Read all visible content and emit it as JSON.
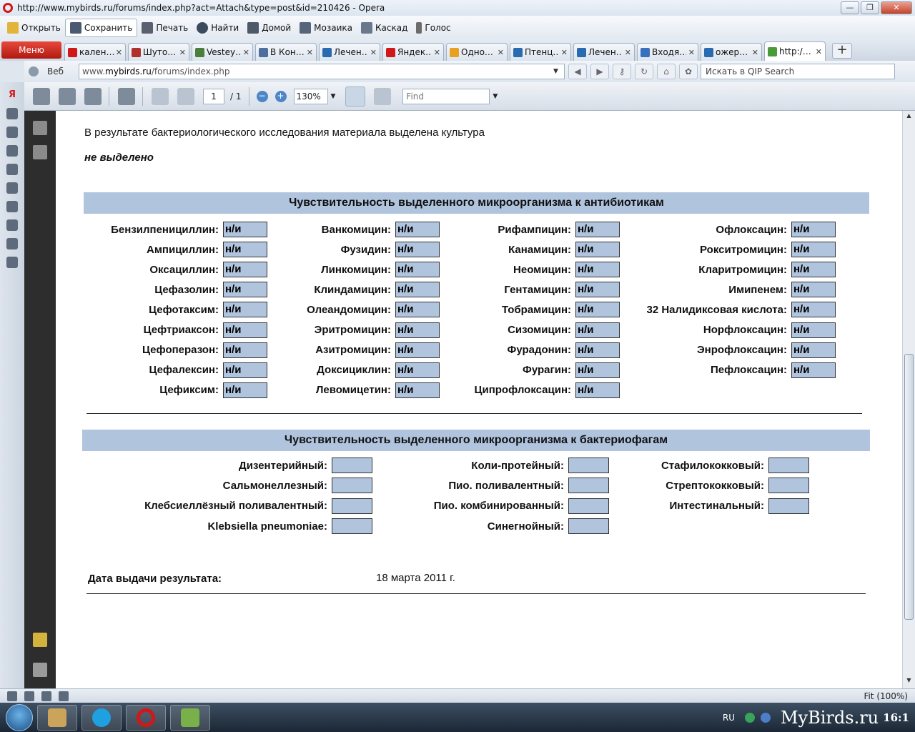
{
  "window": {
    "title": "http://www.mybirds.ru/forums/index.php?act=Attach&type=post&id=210426 - Opera",
    "btn_min": "—",
    "btn_max": "❐",
    "btn_close": "✕"
  },
  "toolbar": {
    "open": "Открыть",
    "save": "Сохранить",
    "print": "Печать",
    "find": "Найти",
    "home": "Домой",
    "tile": "Мозаика",
    "cascade": "Каскад",
    "voice": "Голос"
  },
  "tabs": {
    "menu": "Меню",
    "items": [
      {
        "label": "кален…",
        "color": "#d01818"
      },
      {
        "label": "Шуто…",
        "color": "#b0302a"
      },
      {
        "label": "Vestey…",
        "color": "#4a7e3a"
      },
      {
        "label": "В Кон…",
        "color": "#4d6fa0"
      },
      {
        "label": "Лечен…",
        "color": "#2a6ab0"
      },
      {
        "label": "Яндек…",
        "color": "#d01818"
      },
      {
        "label": "Одно…",
        "color": "#e8a020"
      },
      {
        "label": "Птенц…",
        "color": "#2a6ab0"
      },
      {
        "label": "Лечен…",
        "color": "#2a6ab0"
      },
      {
        "label": "Входя…",
        "color": "#3a6fc0"
      },
      {
        "label": "ожер…",
        "color": "#2a6ab0"
      },
      {
        "label": "http:/…",
        "color": "#4a9a3a"
      }
    ],
    "new_tab": "+"
  },
  "address": {
    "mode": "Веб",
    "url_prefix": "www.",
    "url_domain": "mybirds.ru",
    "url_path": "/forums/index.php",
    "search_placeholder": "Искать в QIP Search"
  },
  "pdf_toolbar": {
    "page": "1",
    "total": "/ 1",
    "zoom": "130%",
    "find_placeholder": "Find"
  },
  "document": {
    "intro": "В результате бактериологического исследования материала выделена культура",
    "culture": "не выделено",
    "antibiotics_title": "Чувствительность выделенного микроорганизма к антибиотикам",
    "antibiotics": [
      [
        {
          "name": "Бензилпенициллин:",
          "value": "н/и"
        },
        {
          "name": "Ампициллин:",
          "value": "н/и"
        },
        {
          "name": "Оксациллин:",
          "value": "н/и"
        },
        {
          "name": "Цефазолин:",
          "value": "н/и"
        },
        {
          "name": "Цефотаксим:",
          "value": "н/и"
        },
        {
          "name": "Цефтриаксон:",
          "value": "н/и"
        },
        {
          "name": "Цефоперазон:",
          "value": "н/и"
        },
        {
          "name": "Цефалексин:",
          "value": "н/и"
        },
        {
          "name": "Цефиксим:",
          "value": "н/и"
        }
      ],
      [
        {
          "name": "Ванкомицин:",
          "value": "н/и"
        },
        {
          "name": "Фузидин:",
          "value": "н/и"
        },
        {
          "name": "Линкомицин:",
          "value": "н/и"
        },
        {
          "name": "Клиндамицин:",
          "value": "н/и"
        },
        {
          "name": "Олеандомицин:",
          "value": "н/и"
        },
        {
          "name": "Эритромицин:",
          "value": "н/и"
        },
        {
          "name": "Азитромицин:",
          "value": "н/и"
        },
        {
          "name": "Доксициклин:",
          "value": "н/и"
        },
        {
          "name": "Левомицетин:",
          "value": "н/и"
        }
      ],
      [
        {
          "name": "Рифампицин:",
          "value": "н/и"
        },
        {
          "name": "Канамицин:",
          "value": "н/и"
        },
        {
          "name": "Неомицин:",
          "value": "н/и"
        },
        {
          "name": "Гентамицин:",
          "value": "н/и"
        },
        {
          "name": "Тобрамицин:",
          "value": "н/и"
        },
        {
          "name": "Сизомицин:",
          "value": "н/и"
        },
        {
          "name": "Фурадонин:",
          "value": "н/и"
        },
        {
          "name": "Фурагин:",
          "value": "н/и"
        },
        {
          "name": "Ципрофлоксацин:",
          "value": "н/и"
        }
      ],
      [
        {
          "name": "Офлоксацин:",
          "value": "н/и"
        },
        {
          "name": "Рокситромицин:",
          "value": "н/и"
        },
        {
          "name": "Кларитромицин:",
          "value": "н/и"
        },
        {
          "name": "Имипенем:",
          "value": "н/и"
        },
        {
          "name": "32 Налидиксовая кислота:",
          "value": "н/и"
        },
        {
          "name": "Норфлоксацин:",
          "value": "н/и"
        },
        {
          "name": "Энрофлоксацин:",
          "value": "н/и"
        },
        {
          "name": "Пефлоксацин:",
          "value": "н/и"
        }
      ]
    ],
    "phages_title": "Чувствительность выделенного микроорганизма к бактериофагам",
    "phages": [
      [
        {
          "name": "Дизентерийный:",
          "value": ""
        },
        {
          "name": "Сальмонеллезный:",
          "value": ""
        },
        {
          "name": "Клебсиеллёзный поливалентный:",
          "value": ""
        },
        {
          "name": "Klebsiella pneumoniae:",
          "value": ""
        }
      ],
      [
        {
          "name": "Коли-протейный:",
          "value": ""
        },
        {
          "name": "Пио. поливалентный:",
          "value": ""
        },
        {
          "name": "Пио. комбинированный:",
          "value": ""
        },
        {
          "name": "Синегнойный:",
          "value": ""
        }
      ],
      [
        {
          "name": "Стафилококковый:",
          "value": ""
        },
        {
          "name": "Стрептококковый:",
          "value": ""
        },
        {
          "name": "Интестинальный:",
          "value": ""
        }
      ]
    ],
    "date_label": "Дата выдачи результата:",
    "date_value": "18 марта 2011 г."
  },
  "statusbar": {
    "zoom": "Fit (100%)"
  },
  "taskbar": {
    "lang": "RU",
    "brand": "MyBirds.ru",
    "clock": "16:1"
  }
}
